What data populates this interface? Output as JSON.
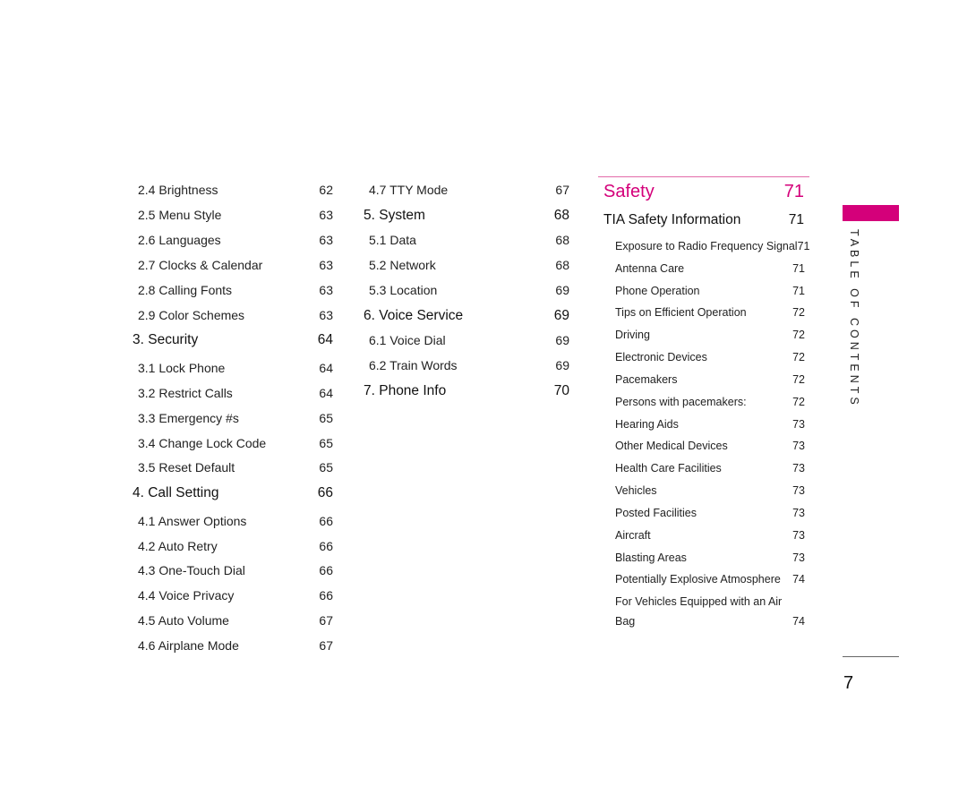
{
  "column1": [
    {
      "label": "2.4 Brightness",
      "page": "62",
      "type": "sub"
    },
    {
      "label": "2.5 Menu Style",
      "page": "63",
      "type": "sub"
    },
    {
      "label": "2.6 Languages",
      "page": "63",
      "type": "sub"
    },
    {
      "label": "2.7 Clocks & Calendar",
      "page": "63",
      "type": "sub"
    },
    {
      "label": "2.8 Calling Fonts",
      "page": "63",
      "type": "sub"
    },
    {
      "label": "2.9 Color Schemes",
      "page": "63",
      "type": "sub"
    },
    {
      "label": "3. Security",
      "page": "64",
      "type": "head"
    },
    {
      "label": "3.1 Lock Phone",
      "page": "64",
      "type": "sub"
    },
    {
      "label": "3.2 Restrict Calls",
      "page": "64",
      "type": "sub"
    },
    {
      "label": "3.3 Emergency #s",
      "page": "65",
      "type": "sub"
    },
    {
      "label": "3.4 Change Lock Code",
      "page": "65",
      "type": "sub"
    },
    {
      "label": "3.5 Reset Default",
      "page": "65",
      "type": "sub"
    },
    {
      "label": "4. Call Setting",
      "page": "66",
      "type": "head"
    },
    {
      "label": "4.1 Answer Options",
      "page": "66",
      "type": "sub"
    },
    {
      "label": "4.2 Auto Retry",
      "page": "66",
      "type": "sub"
    },
    {
      "label": "4.3 One-Touch Dial",
      "page": "66",
      "type": "sub"
    },
    {
      "label": "4.4 Voice Privacy",
      "page": "66",
      "type": "sub"
    },
    {
      "label": "4.5 Auto Volume",
      "page": "67",
      "type": "sub"
    },
    {
      "label": "4.6 Airplane Mode",
      "page": "67",
      "type": "sub"
    }
  ],
  "column2": [
    {
      "label": "4.7 TTY Mode",
      "page": "67",
      "type": "sub"
    },
    {
      "label": "5. System",
      "page": "68",
      "type": "head"
    },
    {
      "label": "5.1 Data",
      "page": "68",
      "type": "sub"
    },
    {
      "label": "5.2 Network",
      "page": "68",
      "type": "sub"
    },
    {
      "label": "5.3 Location",
      "page": "69",
      "type": "sub"
    },
    {
      "label": "6. Voice Service",
      "page": "69",
      "type": "head"
    },
    {
      "label": "6.1 Voice Dial",
      "page": "69",
      "type": "sub"
    },
    {
      "label": "6.2 Train Words",
      "page": "69",
      "type": "sub"
    },
    {
      "label": "7. Phone Info",
      "page": "70",
      "type": "head"
    }
  ],
  "safety": {
    "title": "Safety",
    "page": "71",
    "tia": {
      "label": "TIA Safety Information",
      "page": "71"
    },
    "items": [
      {
        "label": "Exposure to Radio Frequency Signal",
        "page": "71"
      },
      {
        "label": "Antenna Care",
        "page": "71"
      },
      {
        "label": "Phone Operation",
        "page": "71"
      },
      {
        "label": "Tips on Efficient Operation",
        "page": "72"
      },
      {
        "label": "Driving",
        "page": "72"
      },
      {
        "label": "Electronic Devices",
        "page": "72"
      },
      {
        "label": "Pacemakers",
        "page": "72"
      },
      {
        "label": "Persons with pacemakers:",
        "page": "72"
      },
      {
        "label": "Hearing Aids",
        "page": "73"
      },
      {
        "label": "Other Medical Devices",
        "page": "73"
      },
      {
        "label": "Health Care Facilities",
        "page": "73"
      },
      {
        "label": "Vehicles",
        "page": "73"
      },
      {
        "label": "Posted Facilities",
        "page": "73"
      },
      {
        "label": "Aircraft",
        "page": "73"
      },
      {
        "label": "Blasting Areas",
        "page": "73"
      },
      {
        "label": "Potentially Explosive Atmosphere",
        "page": "74"
      }
    ],
    "last_item": {
      "line1": "For Vehicles Equipped with an Air",
      "line2": "Bag",
      "page": "74"
    }
  },
  "side_tab": {
    "label": "TABLE OF CONTENTS",
    "accent": "#d4007a"
  },
  "page_number": "7"
}
